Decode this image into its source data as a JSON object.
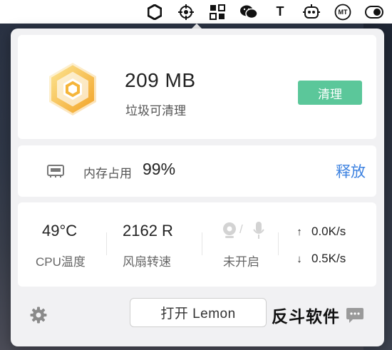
{
  "menubar": {
    "icons": [
      "lemon-hexagon-icon",
      "crosshair-icon",
      "qr-grid-icon",
      "wechat-icon",
      "text-t-icon",
      "robot-icon",
      "mt-badge-icon",
      "toggle-icon"
    ],
    "t_label": "T",
    "mt_label": "MT"
  },
  "junk": {
    "size": "209 MB",
    "label": "垃圾可清理",
    "clean_button": "清理"
  },
  "memory": {
    "label": "内存占用",
    "value": "99%",
    "release_link": "释放"
  },
  "stats": {
    "cpu_temp": "49°C",
    "cpu_label": "CPU温度",
    "fan_speed": "2162 R",
    "fan_label": "风扇转速",
    "privacy_label": "未开启",
    "upload": "0.0K/s",
    "download": "0.5K/s"
  },
  "footer": {
    "open_button": "打开 Lemon",
    "watermark": "反斗软件"
  },
  "colors": {
    "accent_green": "#5bc79a",
    "link_blue": "#3d82e0",
    "logo_orange": "#f5b53a"
  }
}
